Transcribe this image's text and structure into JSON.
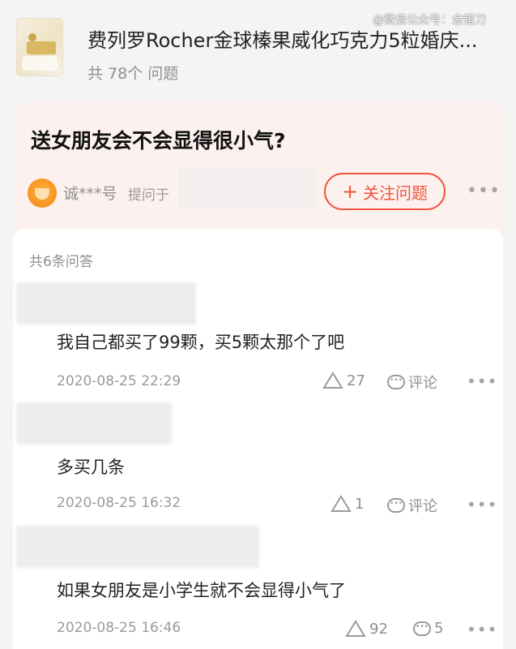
{
  "product": {
    "title": "费列罗Rocher金球榛果威化巧克力5粒婚庆...",
    "question_count": "共 78个 问题"
  },
  "watermark": "@微信公众号：金错刀",
  "question": {
    "text": "送女朋友会不会显得很小气?",
    "asker": "诚***号",
    "asked_label": "提问于",
    "follow_label": "关注问题"
  },
  "answers_count": "共6条问答",
  "answers": [
    {
      "text": "我自己都买了99颗，买5颗太那个了吧",
      "date": "2020-08-25 22:29",
      "likes": "27",
      "comment_label": "评论"
    },
    {
      "text": "多买几条",
      "date": "2020-08-25 16:32",
      "likes": "1",
      "comment_label": "评论"
    },
    {
      "text": "如果女朋友是小学生就不会显得小气了",
      "date": "2020-08-25 16:46",
      "likes": "92",
      "comment_label": "5"
    }
  ],
  "icons": {
    "like": "triangle-up-icon",
    "comment": "speech-bubble-icon",
    "more": "more-dots-icon",
    "follow": "plus-icon"
  },
  "colors": {
    "accent": "#f0553a",
    "question_bg": "#fdf1ef",
    "muted_text": "#8f8f8f"
  }
}
